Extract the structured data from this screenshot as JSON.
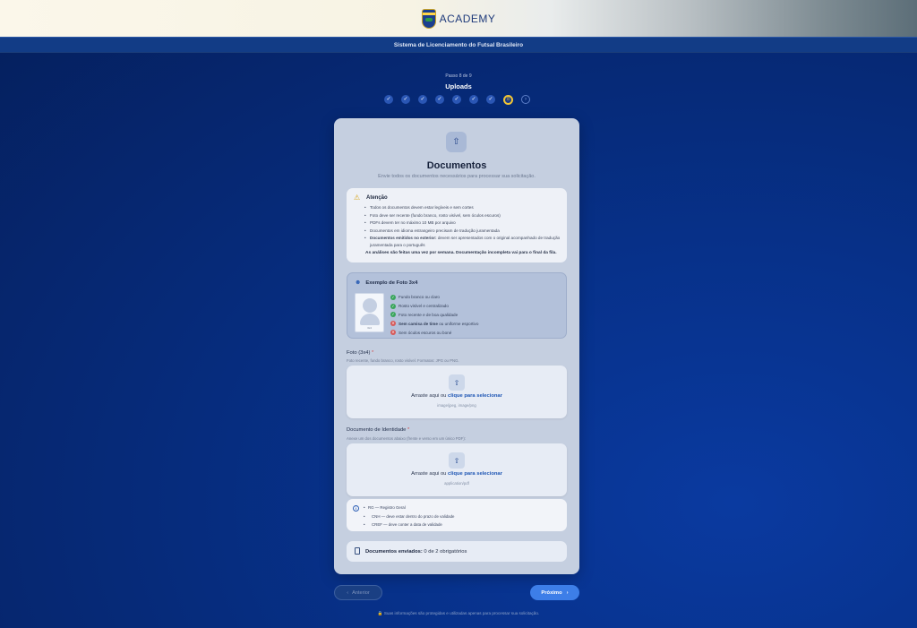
{
  "header": {
    "brand_text": "ACADEMY",
    "system_title": "Sistema de Licenciamento do Futsal Brasileiro"
  },
  "wizard": {
    "step_counter": "Passo 8 de 9",
    "step_name": "Uploads",
    "current_step_label": "8",
    "done_mark": "✓",
    "next_mark": "›"
  },
  "card": {
    "title": "Documentos",
    "subtitle": "Envie todos os documentos necessários para processar sua solicitação."
  },
  "attention": {
    "title": "Atenção",
    "items": [
      "Todos os documentos devem estar legíveis e sem cortes",
      "Foto deve ser recente (fundo branco, rosto visível, sem óculos escuros)",
      "PDFs devem ter no máximo 10 MB por arquivo",
      "Documentos em idioma estrangeiro precisam de tradução juramentada"
    ],
    "foreign_bold": "Documentos emitidos no exterior:",
    "foreign_rest": " devem ser apresentados com o original acompanhado de tradução juramentada para o português",
    "footer": "As análises são feitas uma vez por semana. Documentação incompleta vai para o final da fila."
  },
  "photo_example": {
    "title": "Exemplo de Foto 3x4",
    "sample_label": "3x4",
    "requirements": [
      {
        "text": "Fundo branco ou claro",
        "ok": true
      },
      {
        "text": "Rosto visível e centralizado",
        "ok": true
      },
      {
        "text": "Foto recente e de boa qualidade",
        "ok": true
      },
      {
        "text": "Sem camisa de time ou uniforme esportivo",
        "ok": false
      },
      {
        "text": "Sem óculos escuros ou boné",
        "ok": false
      }
    ],
    "bold_prefix": "Sem camisa de time"
  },
  "photo_field": {
    "label": "Foto (3x4)",
    "required_mark": "*",
    "hint": "Foto recente, fundo branco, rosto visível. Formatos: JPG ou PNG.",
    "drop_text": "Arraste aqui ou ",
    "drop_link": "clique para selecionar",
    "types": "image/jpeg, image/png"
  },
  "id_field": {
    "label": "Documento de Identidade",
    "required_mark": "*",
    "hint": "Anexe um dos documentos abaixo (frente e verso em um único PDF):",
    "drop_text": "Arraste aqui ou ",
    "drop_link": "clique para selecionar",
    "types": "application/pdf"
  },
  "id_info": {
    "items": [
      "RG — Registro Geral",
      "CNH — deve estar dentro do prazo de validade",
      "CREF — deve conter a data de validade"
    ]
  },
  "sent_status": {
    "label": "Documentos enviados:",
    "value": " 0 de 2 obrigatórios"
  },
  "nav": {
    "back_label": "Anterior",
    "next_label": "Próximo"
  },
  "footer": {
    "privacy": "Suas informações são protegidas e utilizadas apenas para processar sua solicitação."
  },
  "icons": {
    "upload": "upload-icon",
    "warning": "warning-icon",
    "person": "person-icon",
    "info": "info-icon",
    "document": "document-icon",
    "lock": "lock-icon"
  },
  "colors": {
    "accent": "#3d7ee8",
    "step_active_ring": "#f1c535",
    "ok": "#3aa55c",
    "error": "#d65a5a"
  }
}
